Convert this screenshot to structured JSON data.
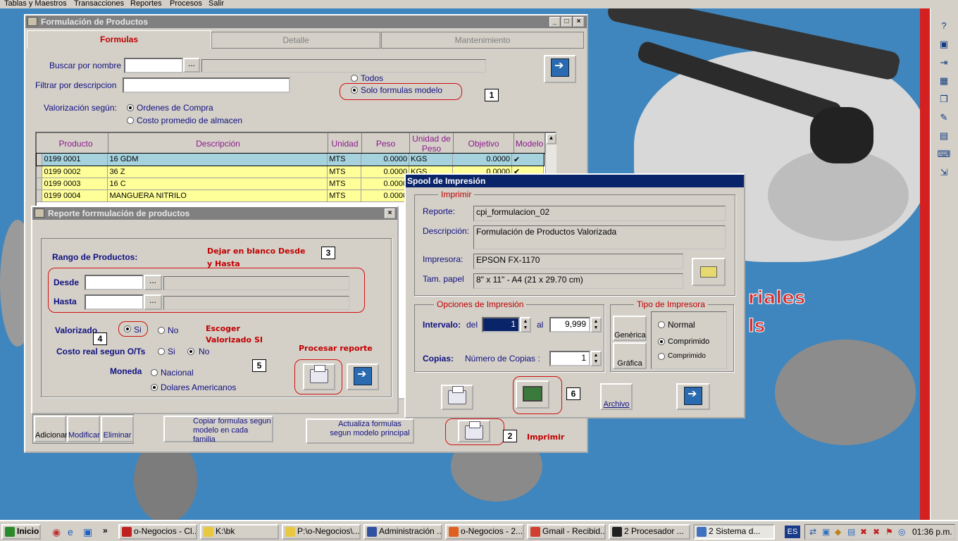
{
  "menubar": [
    "Tablas y Maestros",
    "Transacciones",
    "Reportes",
    "Procesos",
    "Salir"
  ],
  "main_window": {
    "title": "Formulación de Productos",
    "tabs": [
      "Formulas",
      "Detalle",
      "Mantenimiento"
    ],
    "buscar_label": "Buscar por nombre",
    "filtrar_label": "Filtrar por descripcion",
    "radio_todos": "Todos",
    "radio_solo": "Solo formulas modelo",
    "valorizacion_label": "Valorización según:",
    "radio_ordenes": "Ordenes de Compra",
    "radio_costo": "Costo promedio de almacen",
    "columns": [
      "Producto",
      "Descripción",
      "Unidad",
      "Peso",
      "Unidad de Peso",
      "Objetivo",
      "Modelo"
    ],
    "rows": [
      {
        "producto": "0199  0001",
        "desc": "16 GDM",
        "unidad": "MTS",
        "peso": "0.0000",
        "upeso": "KGS",
        "objetivo": "0.0000",
        "modelo": "✔"
      },
      {
        "producto": "0199  0002",
        "desc": "36 Z",
        "unidad": "MTS",
        "peso": "0.0000",
        "upeso": "KGS",
        "objetivo": "0.0000",
        "modelo": "✔"
      },
      {
        "producto": "0199  0003",
        "desc": "16 C",
        "unidad": "MTS",
        "peso": "0.0000",
        "upeso": "",
        "objetivo": "",
        "modelo": ""
      },
      {
        "producto": "0199  0004",
        "desc": "MANGUERA NITRILO",
        "unidad": "MTS",
        "peso": "0.0000",
        "upeso": "",
        "objetivo": "",
        "modelo": ""
      }
    ],
    "bottom_buttons": {
      "adicionar": "Adicionar",
      "modificar": "Modificar",
      "eliminar": "Eliminar",
      "copiar": "Copiar formulas segun modelo en cada familia",
      "actualiza": "Actualiza formulas segun modelo principal"
    },
    "annotation_1": "1",
    "annotation_2": "2",
    "imprimir_note": "Imprimir"
  },
  "report_dialog": {
    "title": "Reporte forrmulación de productos",
    "rango_label": "Rango de Productos:",
    "note_blank_1": "Dejar en blanco Desde",
    "note_blank_2": "y Hasta",
    "desde_label": "Desde",
    "hasta_label": "Hasta",
    "valorizado_label": "Valorizado",
    "si": "Si",
    "no": "No",
    "note_valorizado_1": "Escoger",
    "note_valorizado_2": "Valorizado SI",
    "costo_label": "Costo real segun O/Ts",
    "moneda_label": "Moneda",
    "nacional": "Nacional",
    "dolares": "Dolares Americanos",
    "procesar_note": "Procesar reporte",
    "annotation_3": "3",
    "annotation_4": "4",
    "annotation_5": "5"
  },
  "spool_dialog": {
    "title": "Spool de Impresión",
    "group_imprimir": "Imprimir",
    "reporte_label": "Reporte:",
    "reporte_value": "cpi_formulacion_02",
    "descripcion_label": "Descripción:",
    "descripcion_value": "Formulación de Productos Valorizada",
    "impresora_label": "Impresora:",
    "impresora_value": "EPSON FX-1170",
    "tam_label": "Tam. papel",
    "tam_value": "8\" x 11\"  - A4 (21 x 29.70 cm)",
    "opciones_label": "Opciones de Impresión",
    "intervalo_label": "Intervalo:",
    "del_label": "del",
    "del_value": "1",
    "al_label": "al",
    "al_value": "9,999",
    "copias_label": "Copias:",
    "numcopias_label": "Número de Copias :",
    "copias_value": "1",
    "tipo_label": "Tipo de Impresora",
    "generica": "Genérica",
    "grafica": "Gráfica",
    "normal": "Normal",
    "comprimido1": "Comprimido",
    "comprimido2": "Comprimido",
    "archivo": "Archivo",
    "annotation_6": "6"
  },
  "brand_text": {
    "line1": "riales",
    "line2": "ls"
  },
  "taskbar": {
    "start": "Inicio",
    "tasks": [
      "o-Negocios - Cl...",
      "K:\\bk",
      "P:\\o-Negocios\\...",
      "Administración ...",
      "o-Negocios - 2...",
      "Gmail - Recibid...",
      "2 Procesador ...",
      "2 Sistema d..."
    ],
    "lang": "ES",
    "clock": "01:36 p.m."
  }
}
